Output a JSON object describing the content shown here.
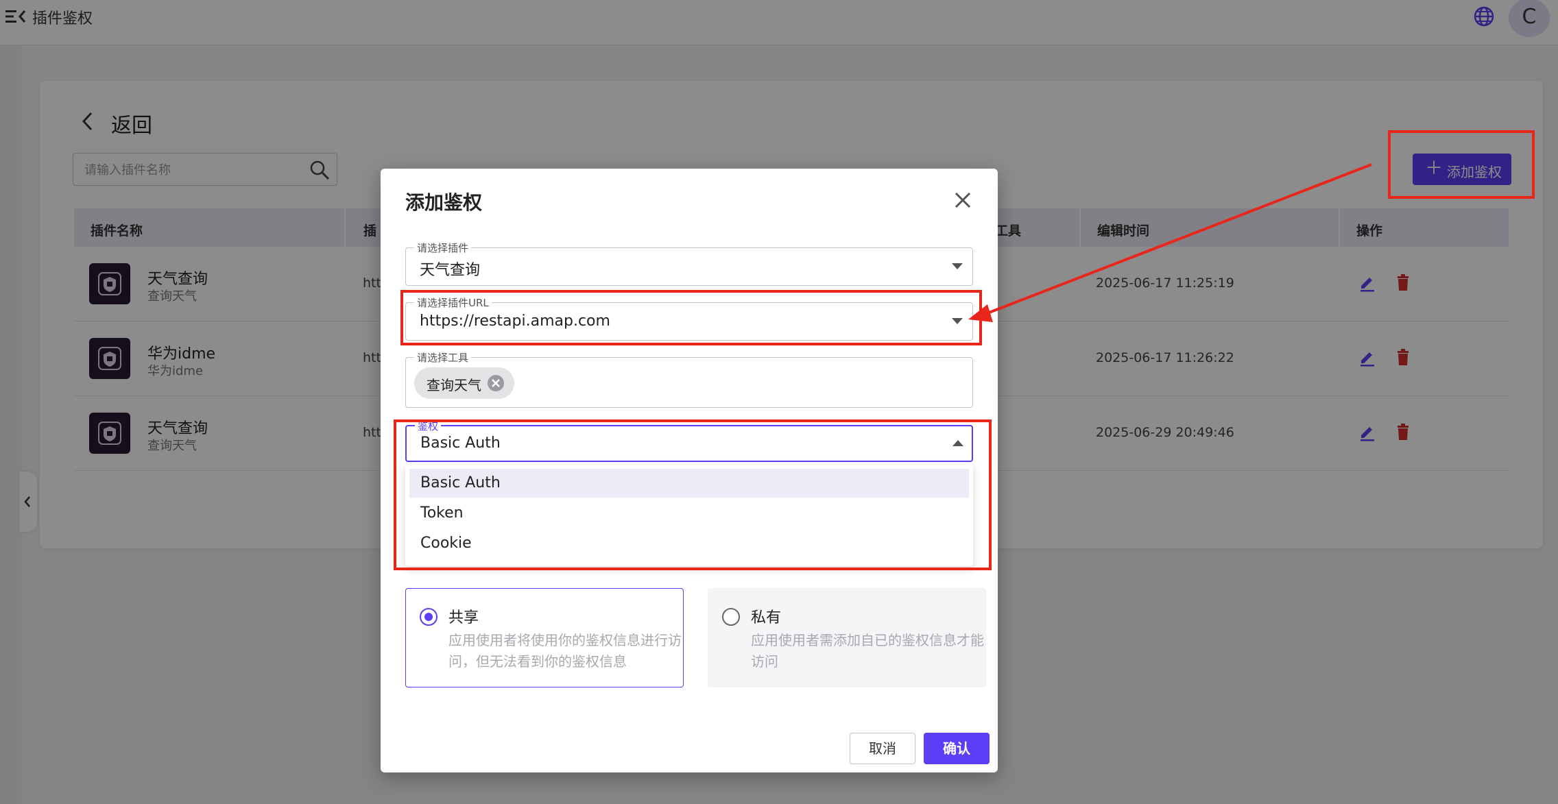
{
  "topbar": {
    "title": "插件鉴权",
    "menu_icon": "menu-collapse-icon",
    "globe_icon": "globe-icon",
    "avatar_letter": "C"
  },
  "page": {
    "back_label": "返回",
    "search_placeholder": "请输入插件名称",
    "add_button_label": "添加鉴权",
    "table": {
      "headers": [
        "插件名称",
        "插",
        "工具",
        "编辑时间",
        "操作"
      ],
      "rows": [
        {
          "name": "天气查询",
          "desc": "查询天气",
          "url": "http",
          "time": "2025-06-17 11:25:19"
        },
        {
          "name": "华为idme",
          "desc": "华为idme",
          "url": "http",
          "time": "2025-06-17 11:26:22"
        },
        {
          "name": "天气查询",
          "desc": "查询天气",
          "url": "http",
          "time": "2025-06-29 20:49:46"
        }
      ]
    }
  },
  "modal": {
    "title": "添加鉴权",
    "plugin_field": {
      "label": "请选择插件",
      "value": "天气查询"
    },
    "url_field": {
      "label": "请选择插件URL",
      "value": "https://restapi.amap.com"
    },
    "tool_field": {
      "label": "请选择工具",
      "chips": [
        "查询天气"
      ]
    },
    "auth_field": {
      "label": "鉴权",
      "value": "Basic Auth"
    },
    "auth_options": [
      "Basic Auth",
      "Token",
      "Cookie"
    ],
    "share_options": [
      {
        "title": "共享",
        "desc": "应用使用者将使用你的鉴权信息进行访问，但无法看到你的鉴权信息",
        "selected": true
      },
      {
        "title": "私有",
        "desc": "应用使用者需添加自已的鉴权信息才能访问",
        "selected": false
      }
    ],
    "cancel_label": "取消",
    "confirm_label": "确认"
  },
  "colors": {
    "accent": "#5b3ef5",
    "annotation": "#e8261c",
    "delete": "#d32f2f"
  }
}
